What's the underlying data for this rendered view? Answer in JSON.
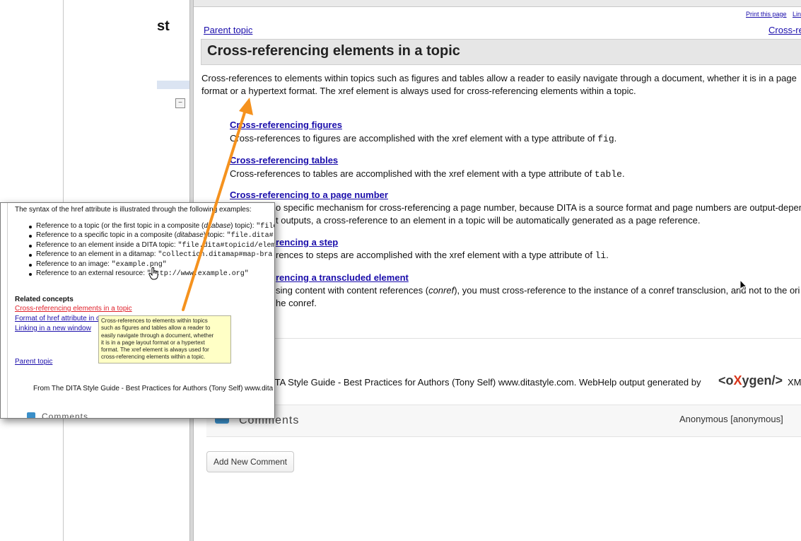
{
  "window": {
    "sidebar_title_fragment": "st",
    "collapse_icon": "collapse-icon",
    "print_link": "Print this page",
    "link_link": "Lin"
  },
  "nav": {
    "parent_topic": "Parent topic",
    "next_topic": "Cross-re"
  },
  "main": {
    "title": "Cross-referencing elements in a topic",
    "intro_line1": "Cross-references to elements within topics such as figures and tables allow a reader to easily navigate through a document, whether it is in a page",
    "intro_line2": "format or a hypertext format. The xref element is always used for cross-referencing elements within a topic.",
    "sections": [
      {
        "link": "Cross-referencing figures",
        "desc_pre": "Cross-references to figures are accomplished with the xref element with a type attribute of ",
        "code": "fig",
        "desc_post": "."
      },
      {
        "link": "Cross-referencing tables",
        "desc_pre": "Cross-references to tables are accomplished with the xref element with a type attribute of ",
        "code": "table",
        "desc_post": "."
      },
      {
        "link": "Cross-referencing to a page number",
        "desc1": "o specific mechanism for cross-referencing a page number, because DITA is a source format and page numbers are output-depen",
        "desc2": "t outputs, a cross-reference to an element in a topic will be automatically generated as a page reference."
      },
      {
        "link": "rencing a step",
        "desc_pre": "rences to steps are accomplished with the xref element with a type attribute of ",
        "code": "li",
        "desc_post": "."
      },
      {
        "link": "rencing a transcluded element",
        "desc1_pre": "sing content with content references (",
        "desc1_em": "conref",
        "desc1_post": "), you must cross-reference to the instance of a conref transclusion, and not to the ori",
        "desc2": "he conref."
      }
    ]
  },
  "footer": {
    "text": "ITA Style Guide - Best Practices for Authors (Tony Self) www.ditastyle.com. WebHelp output generated by",
    "logo_open": "<o",
    "logo_x": "X",
    "logo_rest": "ygen/>",
    "xm_fragment": "XM"
  },
  "comments": {
    "label": "Comments",
    "user": "Anonymous [anonymous]",
    "add_button": "Add New Comment",
    "icon": "comment-bubble-icon"
  },
  "overlay": {
    "intro": "The syntax of the href attribute is illustrated through the following examples:",
    "bullets": [
      {
        "pre": "Reference to a topic (or the first topic in a composite (",
        "em": "ditabase",
        "post": ") topic): ",
        "code": "\"file"
      },
      {
        "pre": "Reference to a specific topic in a composite (",
        "em": "ditabase",
        "post": ") topic: ",
        "code": "\"file.dita#"
      },
      {
        "pre": "Reference to an element inside a DITA topic: ",
        "em": "",
        "post": "",
        "code": "\"file.dita#topicid/elem"
      },
      {
        "pre": "Reference to an element in a ditamap: ",
        "em": "",
        "post": "",
        "code": "\"collection.ditamap#map-bra"
      },
      {
        "pre": "Reference to an image: ",
        "em": "",
        "post": "",
        "code": "\"example.png\""
      },
      {
        "pre": "Reference to an external resource: ",
        "em": "",
        "post": "",
        "code": "\"http://www.example.org\""
      }
    ],
    "related_heading": "Related concepts",
    "related_links": [
      "Cross-referencing elements in a topic",
      "Format of href attribute in c",
      "Linking in a new window"
    ],
    "parent_topic": "Parent topic",
    "footer": "From The DITA Style Guide - Best Practices for Authors (Tony Self) www.dita",
    "comments_fragment": "Comments",
    "tooltip_lines": [
      "Cross-references to elements within topics",
      "such as figures and tables allow a reader to",
      "easily navigate through a document, whether",
      "it is in a page layout format or a hypertext",
      "format. The xref element is always used for",
      "cross-referencing elements within a topic."
    ]
  },
  "colors": {
    "link": "#1a0dab",
    "visited_link": "#e0202a",
    "arrow": "#f5921e",
    "tooltip_bg": "#ffffc6"
  }
}
